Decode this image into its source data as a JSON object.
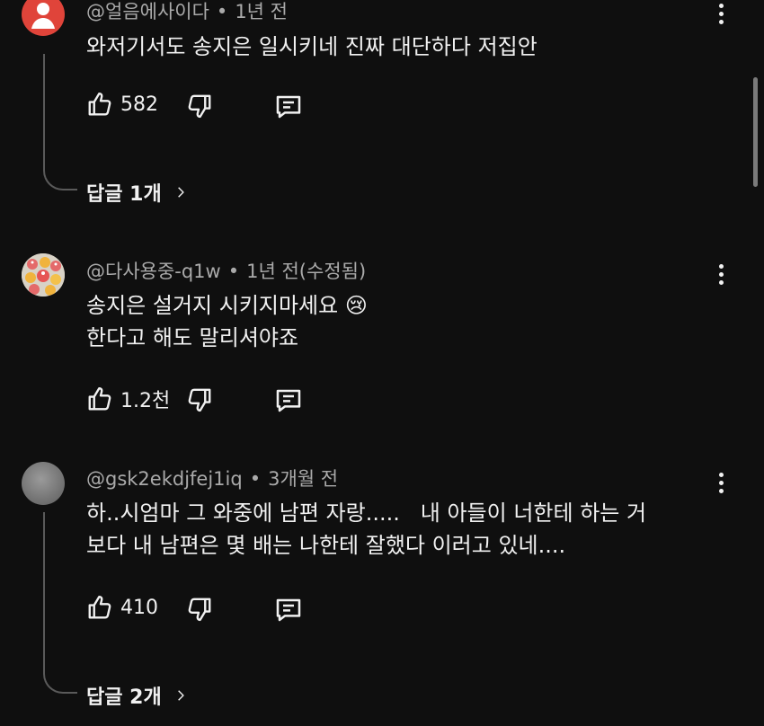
{
  "comments": [
    {
      "author": "@얼음에사이다",
      "time": "1년 전",
      "lines": [
        "와저기서도 송지은 일시키네 진짜 대단하다 저집안"
      ],
      "likes": "582",
      "replies_label": "답글 1개"
    },
    {
      "author": "@다사용중-q1w",
      "time": "1년 전(수정됨)",
      "lines": [
        "송지은 설거지 시키지마세요 😢",
        "한다고 해도 말리셔야죠"
      ],
      "likes": "1.2천"
    },
    {
      "author": "@gsk2ekdjfej1iq",
      "time": "3개월 전",
      "lines": [
        "하..시엄마 그 와중에 남편 자랑.....   내 아들이 너한테 하는 거",
        "보다 내 남편은 몇 배는 나한테 잘했다 이러고 있네...."
      ],
      "likes": "410",
      "replies_label": "답글 2개"
    }
  ],
  "separator": "•",
  "icons": {
    "like": "thumbs-up-icon",
    "dislike": "thumbs-down-icon",
    "reply": "reply-icon",
    "more": "more-vert-icon",
    "chevron": "chevron-right-icon"
  },
  "colors": {
    "background": "#0f0f0f",
    "text": "#f1f1f1",
    "meta": "#aaaaaa",
    "avatar_red": "#e0443a"
  }
}
